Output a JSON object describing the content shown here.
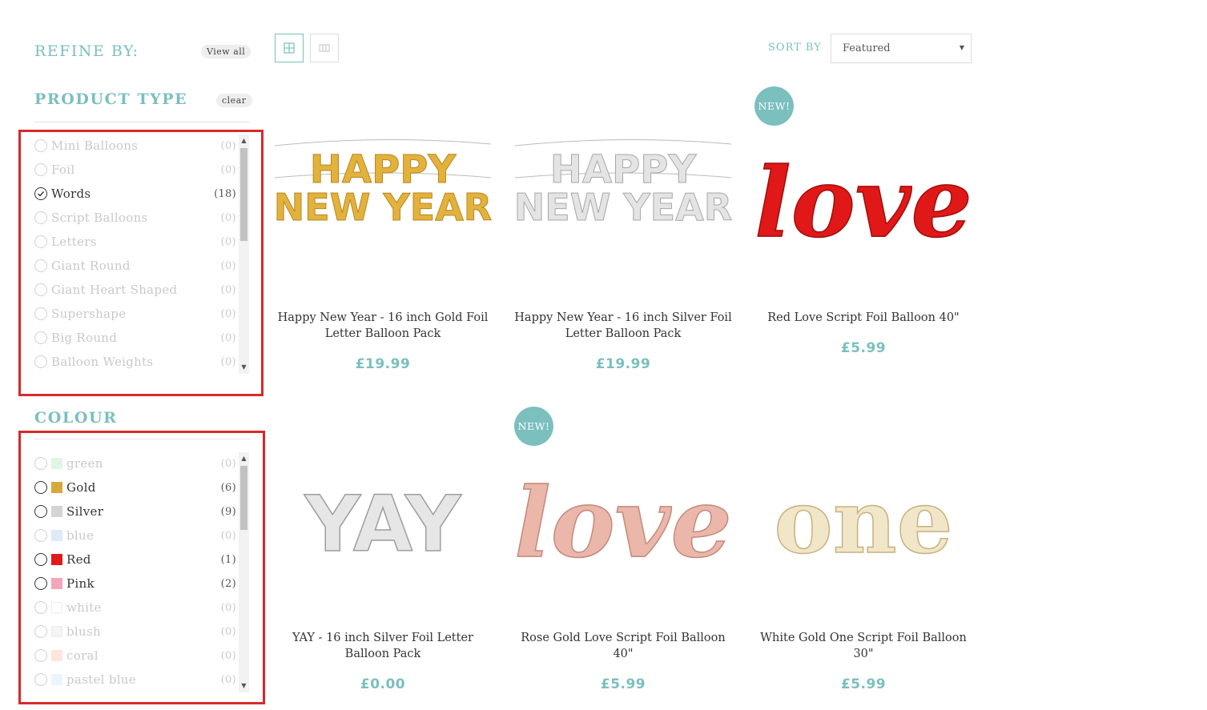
{
  "sidebar": {
    "refine_title": "REFINE BY:",
    "view_all_label": "View all",
    "product_type": {
      "title": "PRODUCT TYPE",
      "clear_label": "clear",
      "items": [
        {
          "label": "Mini Balloons",
          "count": "(0)",
          "state": "disabled"
        },
        {
          "label": "Foil",
          "count": "(0)",
          "state": "disabled"
        },
        {
          "label": "Words",
          "count": "(18)",
          "state": "checked"
        },
        {
          "label": "Script Balloons",
          "count": "(0)",
          "state": "disabled"
        },
        {
          "label": "Letters",
          "count": "(0)",
          "state": "disabled"
        },
        {
          "label": "Giant Round",
          "count": "(0)",
          "state": "disabled"
        },
        {
          "label": "Giant Heart Shaped",
          "count": "(0)",
          "state": "disabled"
        },
        {
          "label": "Supershape",
          "count": "(0)",
          "state": "disabled"
        },
        {
          "label": "Big Round",
          "count": "(0)",
          "state": "disabled"
        },
        {
          "label": "Balloon Weights",
          "count": "(0)",
          "state": "disabled"
        }
      ]
    },
    "colour": {
      "title": "COLOUR",
      "items": [
        {
          "label": "green",
          "count": "(0)",
          "state": "disabled",
          "swatch": "#cfeccf"
        },
        {
          "label": "Gold",
          "count": "(6)",
          "state": "active",
          "swatch": "#d6a93a"
        },
        {
          "label": "Silver",
          "count": "(9)",
          "state": "active",
          "swatch": "#d4d4d4"
        },
        {
          "label": "blue",
          "count": "(0)",
          "state": "disabled",
          "swatch": "#c9dcf2"
        },
        {
          "label": "Red",
          "count": "(1)",
          "state": "active",
          "swatch": "#e01b1b"
        },
        {
          "label": "Pink",
          "count": "(2)",
          "state": "active",
          "swatch": "#f4a7bb"
        },
        {
          "label": "white",
          "count": "(0)",
          "state": "disabled",
          "swatch": "#ffffff"
        },
        {
          "label": "blush",
          "count": "(0)",
          "state": "disabled",
          "swatch": "#eeeeee"
        },
        {
          "label": "coral",
          "count": "(0)",
          "state": "disabled",
          "swatch": "#fbd4cb"
        },
        {
          "label": "pastel blue",
          "count": "(0)",
          "state": "disabled",
          "swatch": "#dff0f7"
        }
      ]
    }
  },
  "toolbar": {
    "sort_label": "SORT BY",
    "sort_value": "Featured"
  },
  "products": [
    {
      "name": "Happy New Year - 16 inch Gold Foil Letter Balloon Pack",
      "price": "£19.99",
      "new": false
    },
    {
      "name": "Happy New Year - 16 inch Silver Foil Letter Balloon Pack",
      "price": "£19.99",
      "new": false
    },
    {
      "name": "Red Love Script Foil Balloon 40\"",
      "price": "£5.99",
      "new": true,
      "badge": "NEW!"
    },
    {
      "name": "YAY - 16 inch Silver Foil Letter Balloon Pack",
      "price": "£0.00",
      "new": false
    },
    {
      "name": "Rose Gold Love Script Foil Balloon 40\"",
      "price": "£5.99",
      "new": true,
      "badge": "NEW!"
    },
    {
      "name": "White Gold One Script Foil Balloon 30\"",
      "price": "£5.99",
      "new": false
    }
  ],
  "images": {
    "hny_gold": {
      "line1": "HAPPY",
      "line2": "NEW YEAR",
      "color": "#e2b23c"
    },
    "hny_silver": {
      "line1": "HAPPY",
      "line2": "NEW YEAR",
      "color": "#d0d0d0"
    },
    "love_red": {
      "text": "love",
      "color": "#e01818"
    },
    "yay": {
      "text": "YAY",
      "color": "#d6d6d6"
    },
    "love_rose": {
      "text": "love",
      "color": "#e8b3a6"
    },
    "one_gold": {
      "text": "one",
      "color": "#eadcb7"
    }
  },
  "colors": {
    "accent": "#7bbfbf",
    "highlight": "#d72a2a"
  }
}
